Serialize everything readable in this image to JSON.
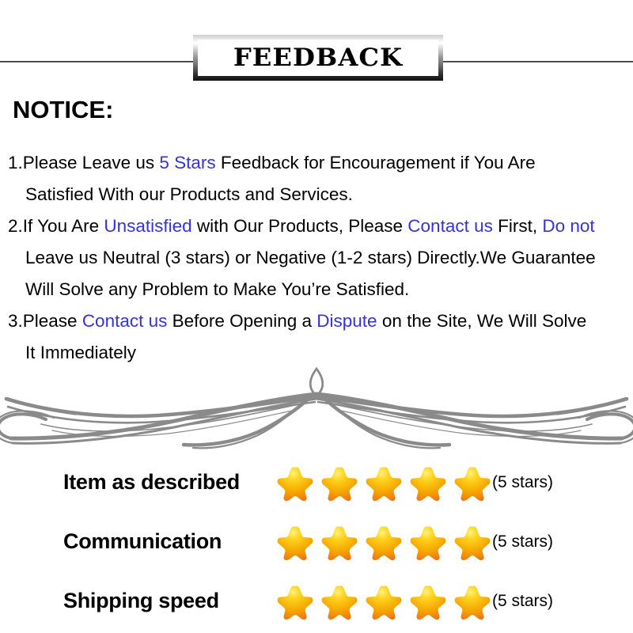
{
  "banner": {
    "title": "FEEDBACK"
  },
  "notice": {
    "heading": "NOTICE:",
    "lines": [
      {
        "segments": [
          {
            "text": "1.Please Leave us  ",
            "color": "black"
          },
          {
            "text": "5 Stars",
            "color": "blue"
          },
          {
            "text": "  Feedback for  Encouragement  if You Are",
            "color": "black"
          }
        ],
        "indent": false
      },
      {
        "segments": [
          {
            "text": "Satisfied With our Products and Services.",
            "color": "black"
          }
        ],
        "indent": true
      },
      {
        "segments": [
          {
            "text": "2.If You Are ",
            "color": "black"
          },
          {
            "text": "Unsatisfied",
            "color": "blue"
          },
          {
            "text": " with Our Products, Please ",
            "color": "black"
          },
          {
            "text": "Contact us",
            "color": "blue"
          },
          {
            "text": " First, ",
            "color": "black"
          },
          {
            "text": "Do not",
            "color": "blue"
          }
        ],
        "indent": false
      },
      {
        "segments": [
          {
            "text": "Leave us Neutral (3 stars) or Negative (1-2 stars) Directly.We Guarantee",
            "color": "black"
          }
        ],
        "indent": true
      },
      {
        "segments": [
          {
            "text": "Will Solve any Problem to Make You’re  Satisfied.",
            "color": "black"
          }
        ],
        "indent": true
      },
      {
        "segments": [
          {
            "text": "3.Please ",
            "color": "black"
          },
          {
            "text": "Contact us",
            "color": "blue"
          },
          {
            "text": " Before Opening a ",
            "color": "black"
          },
          {
            "text": "Dispute",
            "color": "blue"
          },
          {
            "text": " on the Site, We Will Solve",
            "color": "black"
          }
        ],
        "indent": false
      },
      {
        "segments": [
          {
            "text": "It Immediately",
            "color": "black"
          }
        ],
        "indent": true
      }
    ]
  },
  "ornament": {
    "name": "decorative-flourish-divider",
    "color": "#8a8a8a"
  },
  "ratings": {
    "rows": [
      {
        "label": "Item as described",
        "stars": 5,
        "note": "(5 stars)"
      },
      {
        "label": "Communication",
        "stars": 5,
        "note": "(5 stars)"
      },
      {
        "label": "Shipping speed",
        "stars": 5,
        "note": "(5 stars)"
      }
    ],
    "star_colors": {
      "top": "#ffd21e",
      "mid": "#f5a800",
      "bottom": "#e8521c"
    }
  }
}
